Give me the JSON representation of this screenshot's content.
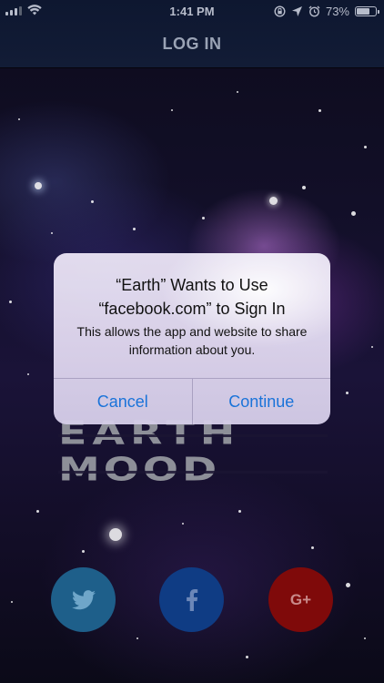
{
  "status_bar": {
    "time": "1:41 PM",
    "battery_percent": "73%",
    "battery_level": 0.73,
    "icons": [
      "cellular-signal-icon",
      "wifi-icon",
      "screen-lock-icon",
      "location-arrow-icon",
      "alarm-icon",
      "battery-icon"
    ]
  },
  "header": {
    "title": "LOG IN"
  },
  "logo": {
    "line1": "EARTH",
    "line2": "MOOD"
  },
  "alert": {
    "title": "“Earth” Wants to Use “facebook.com” to Sign In",
    "message": "This allows the app and website to share information about you.",
    "cancel_label": "Cancel",
    "continue_label": "Continue"
  },
  "social": {
    "gplus_label": "G+",
    "buttons": [
      "twitter-icon",
      "facebook-icon",
      "google-plus-icon"
    ]
  },
  "colors": {
    "header_bg": "#121c36",
    "alert_action": "#1a73d9",
    "twitter": "#1e5f8a",
    "facebook": "#0f3c84",
    "google_plus": "#7f0a0a"
  }
}
